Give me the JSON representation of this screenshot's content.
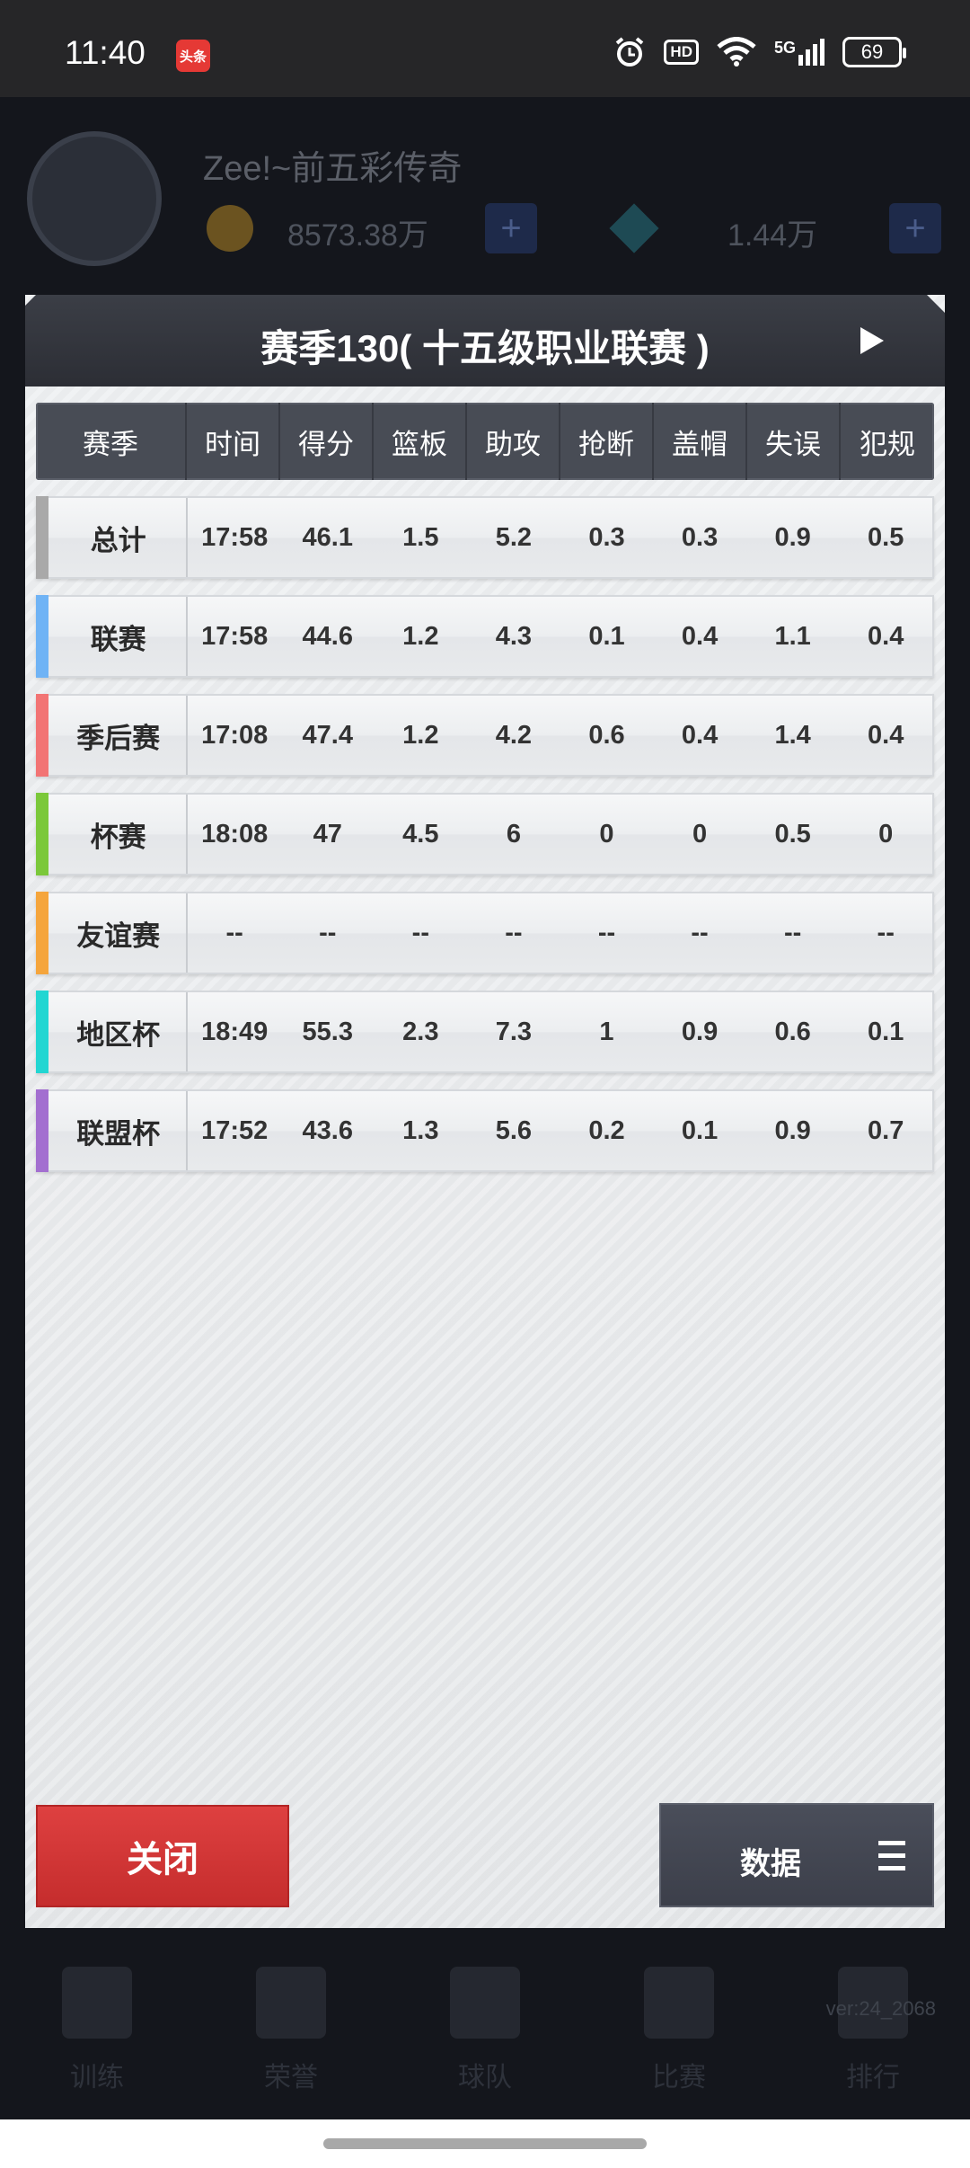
{
  "status_bar": {
    "time": "11:40",
    "app_badge": "头条",
    "hd": "HD",
    "signal": "5G",
    "battery": "69"
  },
  "background": {
    "name": "Zee!~前五彩传奇",
    "coins": "8573.38万",
    "gems": "1.44万",
    "plus": "+",
    "version": "ver:24_2068",
    "nav": [
      "训练",
      "荣誉",
      "球队",
      "比赛",
      "排行"
    ]
  },
  "dialog": {
    "title": "赛季130( 十五级职业联赛 )",
    "columns": [
      "赛季",
      "时间",
      "得分",
      "篮板",
      "助攻",
      "抢断",
      "盖帽",
      "失误",
      "犯规"
    ],
    "rows": [
      {
        "label": "总计",
        "color": "#a9a9a9",
        "values": [
          "17:58",
          "46.1",
          "1.5",
          "5.2",
          "0.3",
          "0.3",
          "0.9",
          "0.5"
        ]
      },
      {
        "label": "联赛",
        "color": "#6fb3f5",
        "values": [
          "17:58",
          "44.6",
          "1.2",
          "4.3",
          "0.1",
          "0.4",
          "1.1",
          "0.4"
        ]
      },
      {
        "label": "季后赛",
        "color": "#f27474",
        "values": [
          "17:08",
          "47.4",
          "1.2",
          "4.2",
          "0.6",
          "0.4",
          "1.4",
          "0.4"
        ]
      },
      {
        "label": "杯赛",
        "color": "#7bc83a",
        "values": [
          "18:08",
          "47",
          "4.5",
          "6",
          "0",
          "0",
          "0.5",
          "0"
        ]
      },
      {
        "label": "友谊赛",
        "color": "#f5a53c",
        "values": [
          "--",
          "--",
          "--",
          "--",
          "--",
          "--",
          "--",
          "--"
        ]
      },
      {
        "label": "地区杯",
        "color": "#22d6d2",
        "values": [
          "18:49",
          "55.3",
          "2.3",
          "7.3",
          "1",
          "0.9",
          "0.6",
          "0.1"
        ]
      },
      {
        "label": "联盟杯",
        "color": "#a36fd0",
        "values": [
          "17:52",
          "43.6",
          "1.3",
          "5.6",
          "0.2",
          "0.1",
          "0.9",
          "0.7"
        ]
      }
    ],
    "close_label": "关闭",
    "data_label": "数据"
  }
}
